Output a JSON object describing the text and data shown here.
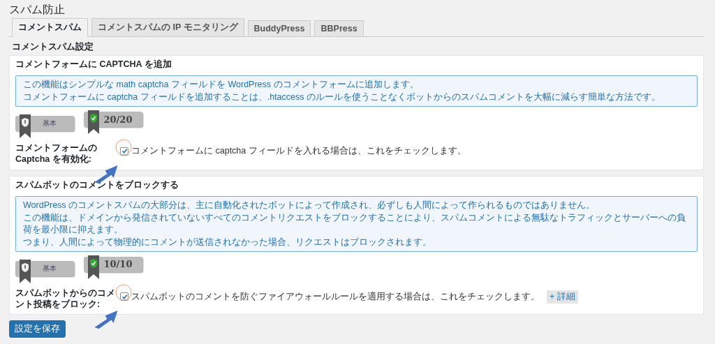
{
  "page_title": "スパム防止",
  "tabs": [
    {
      "label": "コメントスパム",
      "selected": true
    },
    {
      "label": "コメントスパムの IP モニタリング",
      "selected": false
    },
    {
      "label": "BuddyPress",
      "selected": false
    },
    {
      "label": "BBPress",
      "selected": false
    }
  ],
  "section_heading": "コメントスパム設定",
  "panels": [
    {
      "title": "コメントフォームに CAPTCHA を追加",
      "info": [
        "この機能はシンプルな math captcha フィールドを WordPress のコメントフォームに追加します。",
        "コメントフォームに captcha フィールドを追加することは、.htaccess のルールを使うことなくボットからのスパムコメントを大幅に減らす簡単な方法です。"
      ],
      "badges": [
        {
          "label": "基本",
          "kind": "level"
        },
        {
          "label": "20/20",
          "kind": "score"
        }
      ],
      "setting_label": "コメントフォームの Captcha を有効化:",
      "checked": true,
      "description": "コメントフォームに captcha フィールドを入れる場合は、これをチェックします。"
    },
    {
      "title": "スパムボットのコメントをブロックする",
      "info": [
        "WordPress のコメントスパムの大部分は、主に自動化されたボットによって作成され、必ずしも人間によって作られるものではありません。",
        "この機能は、ドメインから発信されていないすべてのコメントリクエストをブロックすることにより、スパムコメントによる無駄なトラフィックとサーバーへの負荷を最小限に抑えます。",
        "つまり、人間によって物理的にコメントが送信されなかった場合、リクエストはブロックされます。"
      ],
      "badges": [
        {
          "label": "基本",
          "kind": "level"
        },
        {
          "label": "10/10",
          "kind": "score"
        }
      ],
      "setting_label": "スパムボットからのコメント投稿をブロック:",
      "checked": true,
      "description": "スパムボットのコメントを防ぐファイアウォールルールを適用する場合は、これをチェックします。",
      "more_label": "+ 詳細"
    }
  ],
  "save_button": "設定を保存"
}
